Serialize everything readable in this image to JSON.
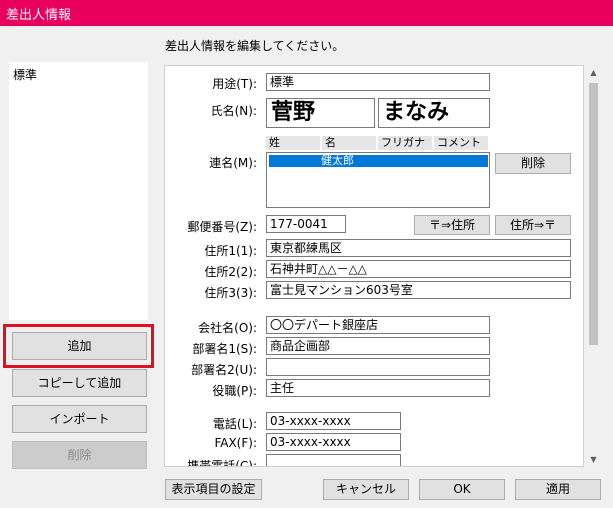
{
  "window": {
    "title": "差出人情報"
  },
  "instruction": "差出人情報を編集してください。",
  "sender_list": {
    "items": [
      "標準"
    ]
  },
  "left_buttons": {
    "add": "追加",
    "copy_add": "コピーして追加",
    "import": "インポート",
    "delete": "削除"
  },
  "form": {
    "usage": {
      "label": "用途(T):",
      "value": "標準"
    },
    "name": {
      "label": "氏名(N):",
      "last": "菅野",
      "first": "まなみ"
    },
    "renmei": {
      "label": "連名(M):",
      "columns": [
        "姓",
        "名",
        "フリガナ",
        "コメント"
      ],
      "selected_row": "健太郎",
      "delete_button": "削除"
    },
    "postal": {
      "label": "郵便番号(Z):",
      "value": "177-0041",
      "to_address_button": "〒⇒住所",
      "to_postal_button": "住所⇒〒"
    },
    "address1": {
      "label": "住所1(1):",
      "value": "東京都練馬区"
    },
    "address2": {
      "label": "住所2(2):",
      "value": "石神井町△△－△△"
    },
    "address3": {
      "label": "住所3(3):",
      "value": "富士見マンション603号室"
    },
    "company": {
      "label": "会社名(O):",
      "value": "〇〇デパート銀座店"
    },
    "dept1": {
      "label": "部署名1(S):",
      "value": "商品企画部"
    },
    "dept2": {
      "label": "部署名2(U):",
      "value": ""
    },
    "title": {
      "label": "役職(P):",
      "value": "主任"
    },
    "phone": {
      "label": "電話(L):",
      "value": "03-xxxx-xxxx"
    },
    "fax": {
      "label": "FAX(F):",
      "value": "03-xxxx-xxxx"
    },
    "mobile": {
      "label": "携帯電話(C):",
      "value": ""
    }
  },
  "bottom_buttons": {
    "display_settings": "表示項目の設定",
    "cancel": "キャンセル",
    "ok": "OK",
    "apply": "適用"
  },
  "colors": {
    "titlebar": "#e8005c",
    "highlight": "#e01020",
    "selection": "#0078d7"
  }
}
